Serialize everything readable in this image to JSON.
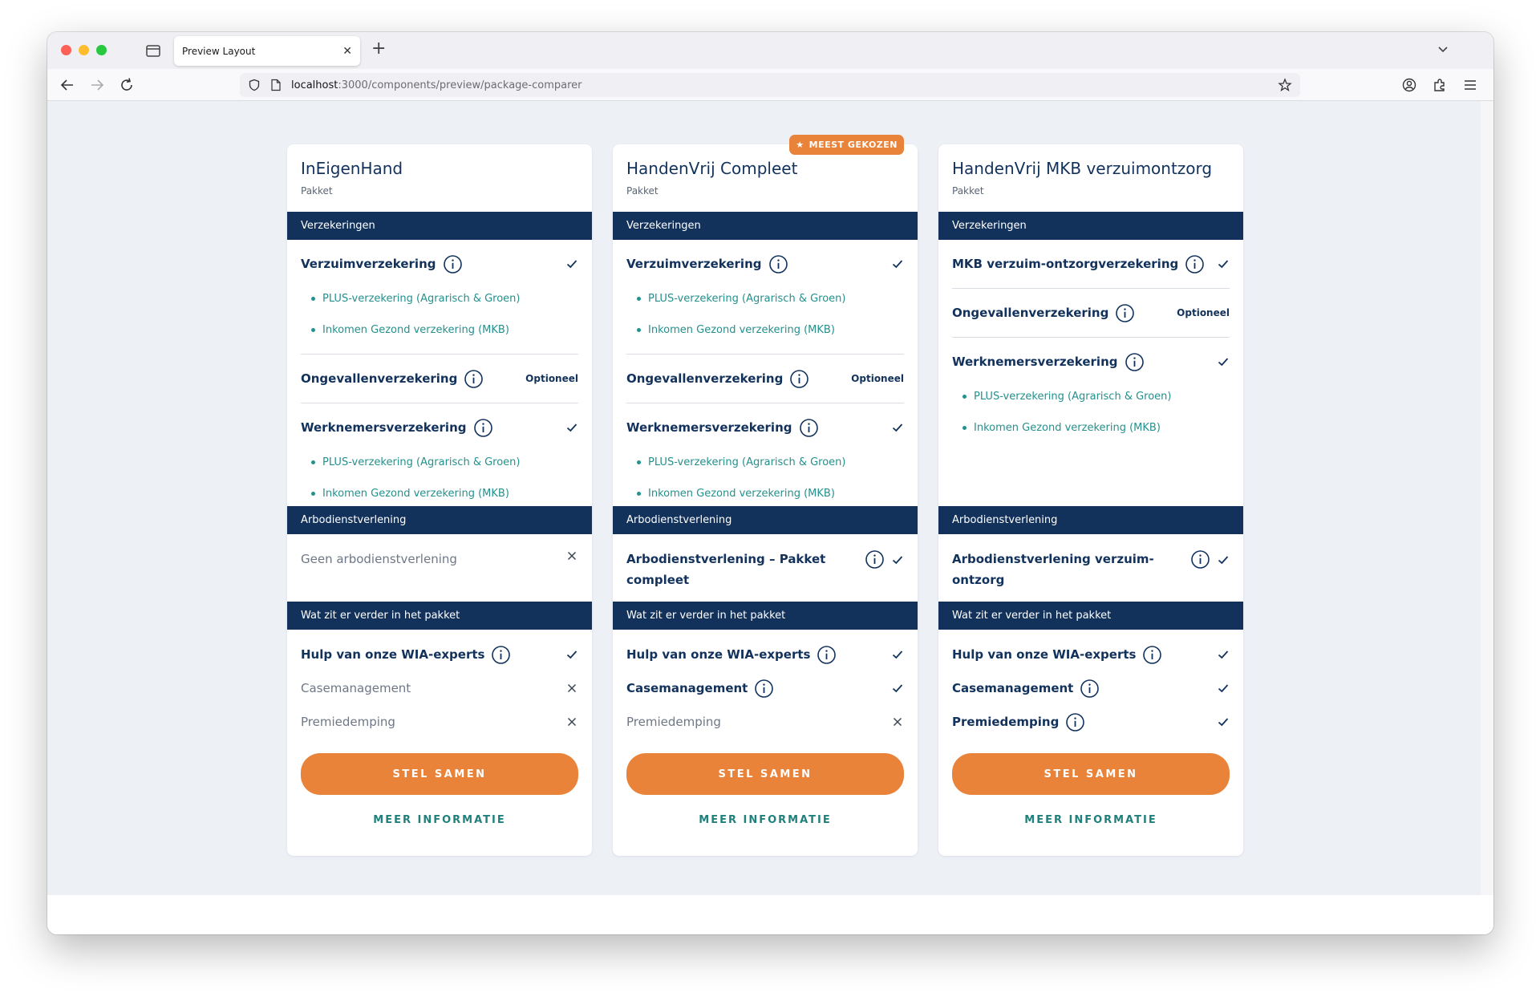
{
  "browser": {
    "tab_title": "Preview Layout",
    "url_host": "localhost",
    "url_path": ":3000/components/preview/package-comparer"
  },
  "icons": {
    "close": "close-icon",
    "new_tab": "plus-icon",
    "info": "info-icon",
    "check": "check-icon",
    "cross": "cross-icon",
    "star": "star-icon"
  },
  "colors": {
    "navy": "#12325c",
    "orange": "#e9833a",
    "teal": "#25908c",
    "background": "#edf1f6"
  },
  "labels": {
    "section_insurances": "Verzekeringen",
    "section_arbo": "Arbodienstverlening",
    "section_extra": "Wat zit er verder in het pakket",
    "package_sub": "Pakket",
    "optional": "Optioneel",
    "cta_primary": "STEL SAMEN",
    "cta_secondary": "MEER INFORMATIE",
    "badge": "MEEST GEKOZEN"
  },
  "packages": [
    {
      "title": "InEigenHand",
      "subtitle": "Pakket",
      "insurances": [
        {
          "label": "Verzuimverzekering",
          "status": "check",
          "subs": [
            "PLUS-verzekering (Agrarisch & Groen)",
            "Inkomen Gezond verzekering (MKB)"
          ]
        },
        {
          "label": "Ongevallenverzekering",
          "status": "Optioneel",
          "subs": []
        },
        {
          "label": "Werknemersverzekering",
          "status": "check",
          "subs": [
            "PLUS-verzekering (Agrarisch & Groen)",
            "Inkomen Gezond verzekering (MKB)"
          ]
        }
      ],
      "arbo": {
        "label": "Geen arbodienstverlening",
        "status": "cross"
      },
      "extras": [
        {
          "label": "Hulp van onze WIA-experts",
          "status": "check"
        },
        {
          "label": "Casemanagement",
          "status": "cross"
        },
        {
          "label": "Premiedemping",
          "status": "cross"
        }
      ]
    },
    {
      "title": "HandenVrij Compleet",
      "subtitle": "Pakket",
      "badge": "MEEST GEKOZEN",
      "insurances": [
        {
          "label": "Verzuimverzekering",
          "status": "check",
          "subs": [
            "PLUS-verzekering (Agrarisch & Groen)",
            "Inkomen Gezond verzekering (MKB)"
          ]
        },
        {
          "label": "Ongevallenverzekering",
          "status": "Optioneel",
          "subs": []
        },
        {
          "label": "Werknemersverzekering",
          "status": "check",
          "subs": [
            "PLUS-verzekering (Agrarisch & Groen)",
            "Inkomen Gezond verzekering (MKB)"
          ]
        }
      ],
      "arbo": {
        "label": "Arbodienstverlening – Pakket compleet",
        "status": "check"
      },
      "extras": [
        {
          "label": "Hulp van onze WIA-experts",
          "status": "check"
        },
        {
          "label": "Casemanagement",
          "status": "check"
        },
        {
          "label": "Premiedemping",
          "status": "cross"
        }
      ]
    },
    {
      "title": "HandenVrij MKB verzuimontzorg",
      "subtitle": "Pakket",
      "insurances": [
        {
          "label": "MKB verzuim-ontzorgverzekering",
          "status": "check",
          "subs": []
        },
        {
          "label": "Ongevallenverzekering",
          "status": "Optioneel",
          "subs": []
        },
        {
          "label": "Werknemersverzekering",
          "status": "check",
          "subs": [
            "PLUS-verzekering (Agrarisch & Groen)",
            "Inkomen Gezond verzekering (MKB)"
          ]
        }
      ],
      "arbo": {
        "label": "Arbodienstverlening verzuim-ontzorg",
        "status": "check"
      },
      "extras": [
        {
          "label": "Hulp van onze WIA-experts",
          "status": "check"
        },
        {
          "label": "Casemanagement",
          "status": "check"
        },
        {
          "label": "Premiedemping",
          "status": "check"
        }
      ]
    }
  ]
}
